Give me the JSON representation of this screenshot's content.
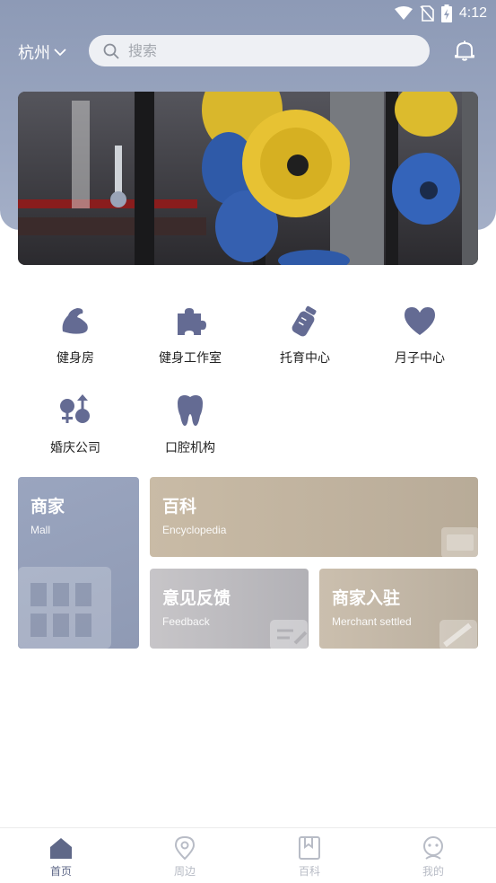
{
  "status_bar": {
    "time": "4:12"
  },
  "header": {
    "city": "杭州",
    "search_placeholder": "搜索"
  },
  "categories": [
    {
      "label": "健身房",
      "icon": "muscle-icon"
    },
    {
      "label": "健身工作室",
      "icon": "puzzle-icon"
    },
    {
      "label": "托育中心",
      "icon": "baby-bottle-icon"
    },
    {
      "label": "月子中心",
      "icon": "heart-icon"
    },
    {
      "label": "婚庆公司",
      "icon": "gender-icon"
    },
    {
      "label": "口腔机构",
      "icon": "tooth-icon"
    }
  ],
  "cards": {
    "mall": {
      "title": "商家",
      "subtitle": "Mall"
    },
    "encyclopedia": {
      "title": "百科",
      "subtitle": "Encyclopedia"
    },
    "feedback": {
      "title": "意见反馈",
      "subtitle": "Feedback"
    },
    "merchant": {
      "title": "商家入驻",
      "subtitle": "Merchant settled"
    }
  },
  "tabs": [
    {
      "label": "首页",
      "icon": "home-icon",
      "active": true
    },
    {
      "label": "周边",
      "icon": "location-pin-icon",
      "active": false
    },
    {
      "label": "百科",
      "icon": "bookmark-icon",
      "active": false
    },
    {
      "label": "我的",
      "icon": "profile-icon",
      "active": false
    }
  ],
  "colors": {
    "accent": "#5f6888",
    "header": "#95a1bb",
    "tab_inactive": "#b8bcc6"
  }
}
